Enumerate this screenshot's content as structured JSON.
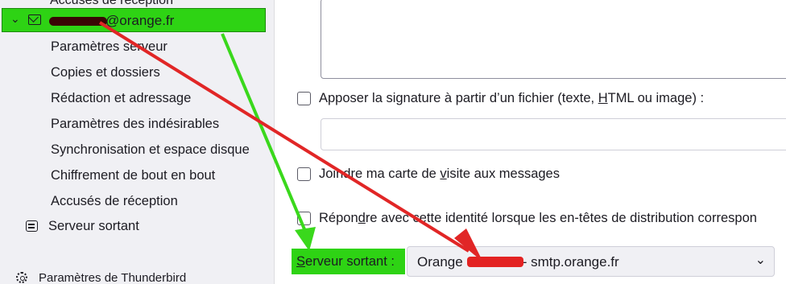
{
  "sidebar": {
    "cut_item": "Accusés de réception",
    "account": {
      "label": "@orange.fr"
    },
    "items": [
      {
        "label": "Paramètres serveur"
      },
      {
        "label": "Copies et dossiers"
      },
      {
        "label": "Rédaction et adressage"
      },
      {
        "label": "Paramètres des indésirables"
      },
      {
        "label": "Synchronisation et espace disque"
      },
      {
        "label": "Chiffrement de bout en bout"
      },
      {
        "label": "Accusés de réception"
      }
    ],
    "outgoing_server": "Serveur sortant",
    "thunderbird_settings": "Paramètres de Thunderbird"
  },
  "main": {
    "attach_signature": {
      "pre": "Apposer la signature à partir d’un fichier (texte, ",
      "accel": "H",
      "post": "TML ou image) :"
    },
    "attach_vcard": {
      "pre": "Joindre ma carte de ",
      "accel": "v",
      "post": "isite aux messages"
    },
    "reply_identity": {
      "pre": "Répon",
      "accel": "d",
      "post": "re avec cette identité lorsque les en-têtes de distribution correspon"
    },
    "outgoing": {
      "accel": "S",
      "label_rest": "erveur sortant :",
      "select_pre": "Orange",
      "select_post": "- smtp.orange.fr"
    }
  },
  "annotations": {
    "colors": {
      "highlight": "#2ed314",
      "arrow_green": "#3ad81c",
      "arrow_red": "#e12626"
    }
  }
}
